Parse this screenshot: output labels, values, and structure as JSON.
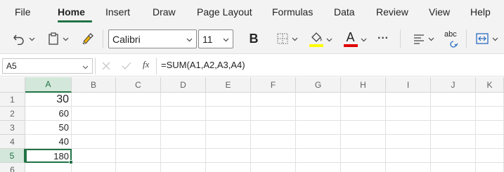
{
  "menu": {
    "items": [
      {
        "label": "File"
      },
      {
        "label": "Home"
      },
      {
        "label": "Insert"
      },
      {
        "label": "Draw"
      },
      {
        "label": "Page Layout"
      },
      {
        "label": "Formulas"
      },
      {
        "label": "Data"
      },
      {
        "label": "Review"
      },
      {
        "label": "View"
      },
      {
        "label": "Help"
      }
    ],
    "active": "Home"
  },
  "ribbon": {
    "font_name": "Calibri",
    "font_size": "11",
    "bold_label": "B",
    "font_color_label": "A",
    "more_label": "···",
    "spelling_label": "abc",
    "colors": {
      "highlight": "#ffff00",
      "font_color": "#e00000"
    },
    "icons": [
      "undo-icon",
      "clipboard-icon",
      "format-painter-icon",
      "borders-icon",
      "fill-color-icon",
      "align-icon",
      "spelling-icon",
      "wrap-icon"
    ]
  },
  "formula_bar": {
    "name_box": "A5",
    "fx_label": "fx",
    "formula": "=SUM(A1,A2,A3,A4)"
  },
  "grid": {
    "columns": [
      "A",
      "B",
      "C",
      "D",
      "E",
      "F",
      "G",
      "H",
      "I",
      "J",
      "K"
    ],
    "rows": [
      "1",
      "2",
      "3",
      "4",
      "5",
      "6"
    ],
    "selected_column": "A",
    "selected_row": "5",
    "cells": {
      "A1": "30",
      "A2": "60",
      "A3": "50",
      "A4": "40",
      "A5": "180"
    },
    "accent_color": "#217346"
  }
}
